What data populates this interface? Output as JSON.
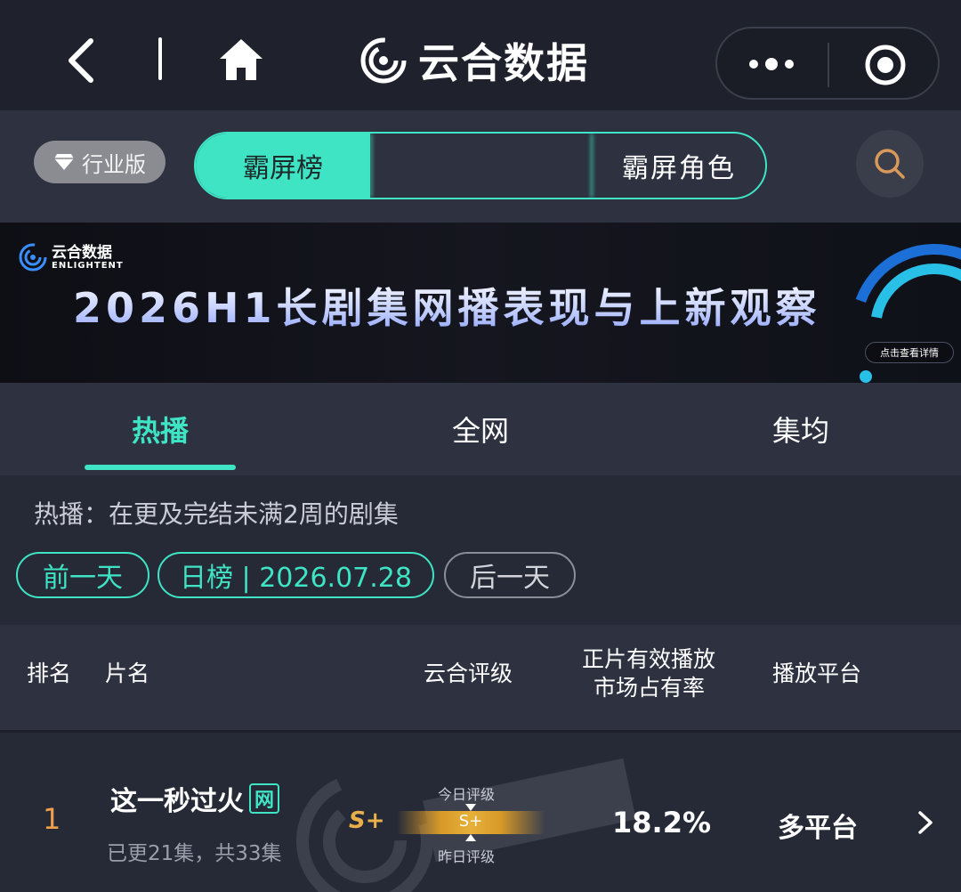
{
  "topbar": {
    "brand_name": "云合数据",
    "icons": [
      "back-icon",
      "home-icon",
      "brand-logo",
      "more-dots-icon",
      "target-icon"
    ]
  },
  "toolbar": {
    "edition_label": "行业版",
    "segments": [
      "霸屏榜",
      "",
      "霸屏角色"
    ],
    "search_icon": "search-icon",
    "accent_color": "#3ee4c4"
  },
  "banner": {
    "logo_name": "云合数据",
    "logo_en": "ENLIGHTENT",
    "title": "2026H1长剧集网播表现与上新观察",
    "cta": "点击查看详情"
  },
  "tabs": [
    {
      "label": "热播",
      "active": true
    },
    {
      "label": "全网",
      "active": false
    },
    {
      "label": "集均",
      "active": false
    }
  ],
  "info_text": "热播：在更及完结未满2周的剧集",
  "date_nav": {
    "prev": "前一天",
    "current": "日榜 | 2026.07.28",
    "next": "后一天"
  },
  "table": {
    "headers": {
      "rank": "排名",
      "name": "片名",
      "grade": "云合评级",
      "share_line1": "正片有效播放",
      "share_line2": "市场占有率",
      "platform": "播放平台"
    },
    "rows": [
      {
        "rank": "1",
        "title": "这一秒过火",
        "badge": "网",
        "episodes": "已更21集，共33集",
        "grade": "S+",
        "today_label": "今日评级",
        "today_grade": "S+",
        "yesterday_label": "昨日评级",
        "share": "18.2%",
        "platform": "多平台"
      }
    ]
  }
}
